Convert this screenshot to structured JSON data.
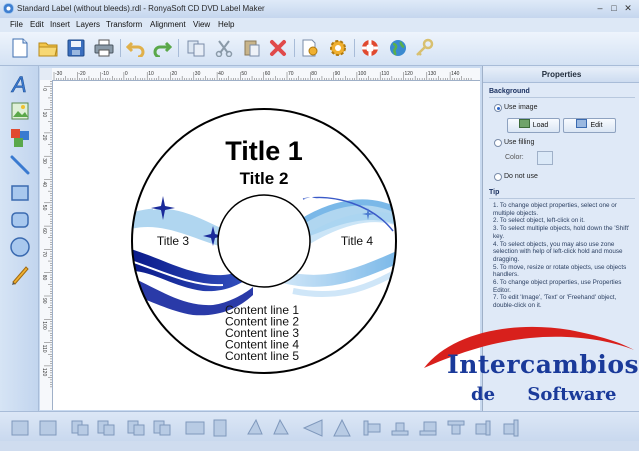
{
  "window": {
    "title": "Standard Label (without bleeds).rdl - RonyaSoft CD DVD Label Maker"
  },
  "menu": {
    "items": [
      "File",
      "Edit",
      "Insert",
      "Layers",
      "Transform",
      "Alignment",
      "View",
      "Help"
    ]
  },
  "toolbar": {
    "icons": [
      "new-document-icon",
      "open-folder-icon",
      "save-icon",
      "print-icon",
      "undo-icon",
      "redo-icon",
      "copy-icon",
      "cut-icon",
      "paste-icon",
      "delete-icon",
      "properties-icon",
      "settings-gear-icon",
      "help-lifebuoy-icon",
      "web-globe-icon",
      "key-icon"
    ]
  },
  "left_tools": {
    "icons": [
      "text-tool-icon",
      "image-tool-icon",
      "object-tool-icon",
      "line-tool-icon",
      "rectangle-tool-icon",
      "rounded-rectangle-tool-icon",
      "ellipse-tool-icon",
      "freehand-pencil-tool-icon"
    ]
  },
  "ruler": {
    "unit": "mm",
    "h_ticks": [
      "-30",
      "-20",
      "-10",
      "0",
      "10",
      "20",
      "30",
      "40",
      "50",
      "60",
      "70",
      "80",
      "90",
      "100",
      "110",
      "120",
      "130",
      "140"
    ],
    "v_ticks": [
      "-10",
      "0",
      "10",
      "20",
      "30",
      "40",
      "50",
      "60",
      "70",
      "80",
      "90",
      "100",
      "110",
      "120"
    ]
  },
  "label": {
    "title1": "Title 1",
    "title2": "Title 2",
    "title3": "Title 3",
    "title4": "Title 4",
    "content": [
      "Content line 1",
      "Content line 2",
      "Content line 3",
      "Content line 4",
      "Content line 5"
    ]
  },
  "properties": {
    "header": "Properties",
    "background_section": "Background",
    "use_image": "Use image",
    "load_button": "Load",
    "edit_button": "Edit",
    "use_filling": "Use filling",
    "color_label": "Color:",
    "do_not_use": "Do not use",
    "selected_option": "Use image",
    "tip_section": "Tip",
    "tip_text": "1. To change object properties, select one or multiple objects.\n2. To select object, left-click on it.\n3. To select multiple objects, hold down the 'Shift' key.\n4. To select objects, you may also use zone selection with help of left-click hold and mouse dragging.\n5. To move, resize or rotate objects, use objects handlers.\n6. To change object properties, use Properties Editor.\n7. To edit 'Image', 'Text' or 'Freehand' object, double-click on it."
  },
  "watermark": {
    "line1": "Intercambios",
    "line2a": "de",
    "line2b": "Software"
  },
  "colors": {
    "accent": "#1a3a9a",
    "swirl_dark": "#1a2a9a",
    "swirl_light": "#8fc4ea",
    "watermark_red": "#d8201c"
  }
}
